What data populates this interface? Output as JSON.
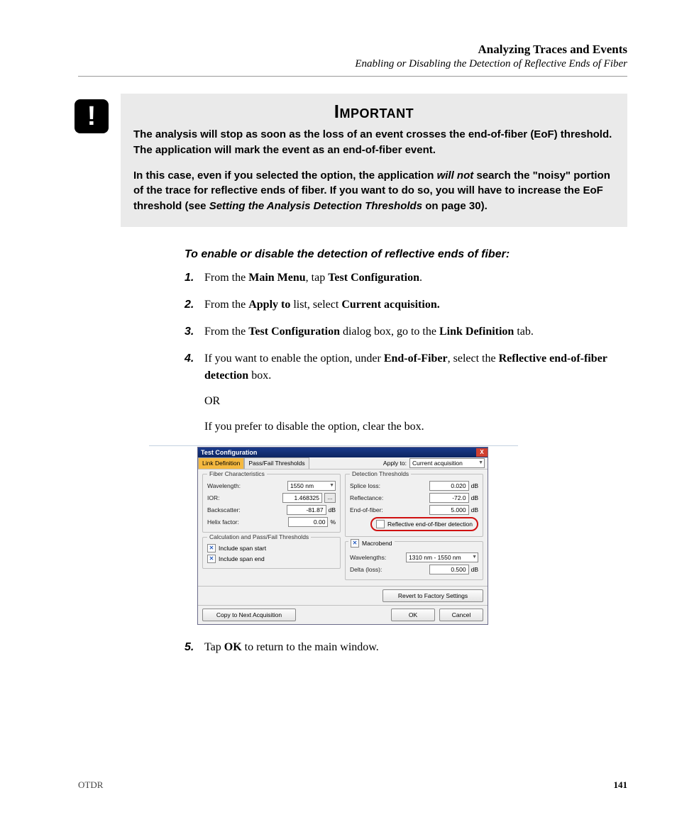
{
  "header": {
    "chapter": "Analyzing Traces and Events",
    "section": "Enabling or Disabling the Detection of Reflective Ends of Fiber"
  },
  "important": {
    "heading": "Important",
    "p1": "The analysis will stop as soon as the loss of an event crosses the end-of-fiber (EoF) threshold. The application will mark the event as an end-of-fiber event.",
    "p2a": "In this case, even if you selected the option, the application ",
    "p2_em": "will not",
    "p2b": " search the \"noisy\" portion of the trace for reflective ends of fiber. If you want to do so, you will have to increase the EoF threshold (see ",
    "p2_ref": "Setting the Analysis Detection Thresholds",
    "p2c": " on page 30)."
  },
  "procedure": {
    "title": "To enable or disable the detection of reflective ends of fiber:",
    "s1_a": "From the ",
    "s1_b1": "Main Menu",
    "s1_c": ", tap ",
    "s1_b2": "Test Configuration",
    "s1_d": ".",
    "s2_a": "From the ",
    "s2_b1": "Apply to",
    "s2_c": " list, select ",
    "s2_b2": "Current acquisition.",
    "s3_a": "From the ",
    "s3_b1": "Test Configuration",
    "s3_c": " dialog box, go to the ",
    "s3_b2": "Link Definition",
    "s3_d": " tab.",
    "s4_a": "If you want to enable the option, under ",
    "s4_b1": "End-of-Fiber",
    "s4_c": ", select the ",
    "s4_b2": "Reflective end-of-fiber detection",
    "s4_d": " box.",
    "s4_or": "OR",
    "s4_p2": "If you prefer to disable the option, clear the box.",
    "s5_a": "Tap ",
    "s5_b": "OK",
    "s5_c": " to return to the main window."
  },
  "dialog": {
    "title": "Test Configuration",
    "close": "X",
    "tabs": {
      "link": "Link Definition",
      "passfail": "Pass/Fail Thresholds"
    },
    "apply_label": "Apply to:",
    "apply_value": "Current acquisition",
    "fiber": {
      "legend": "Fiber Characteristics",
      "wavelength_lbl": "Wavelength:",
      "wavelength_val": "1550 nm",
      "ior_lbl": "IOR:",
      "ior_val": "1.468325",
      "ior_btn": "...",
      "backscatter_lbl": "Backscatter:",
      "backscatter_val": "-81.87",
      "backscatter_unit": "dB",
      "helix_lbl": "Helix factor:",
      "helix_val": "0.00",
      "helix_unit": "%"
    },
    "calc": {
      "legend": "Calculation and Pass/Fail Thresholds",
      "span_start": "Include span start",
      "span_end": "Include span end"
    },
    "det": {
      "legend": "Detection Thresholds",
      "splice_lbl": "Splice loss:",
      "splice_val": "0.020",
      "splice_unit": "dB",
      "refl_lbl": "Reflectance:",
      "refl_val": "-72.0",
      "refl_unit": "dB",
      "eof_lbl": "End-of-fiber:",
      "eof_val": "5.000",
      "eof_unit": "dB",
      "refl_eof": "Reflective end-of-fiber detection"
    },
    "macro": {
      "chk": "Macrobend",
      "wave_lbl": "Wavelengths:",
      "wave_val": "1310 nm - 1550 nm",
      "delta_lbl": "Delta (loss):",
      "delta_val": "0.500",
      "delta_unit": "dB"
    },
    "revert": "Revert to Factory Settings",
    "copy": "Copy to Next Acquisition",
    "ok": "OK",
    "cancel": "Cancel"
  },
  "footer": {
    "left": "OTDR",
    "page": "141"
  }
}
